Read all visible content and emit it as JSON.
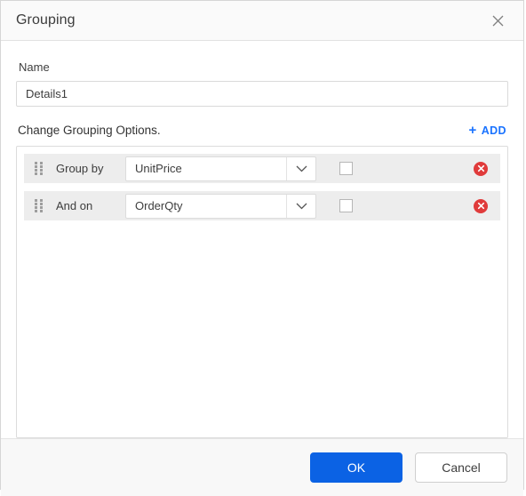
{
  "dialog": {
    "title": "Grouping",
    "close_icon": "close-icon"
  },
  "form": {
    "name_label": "Name",
    "name_value": "Details1",
    "name_placeholder": ""
  },
  "options": {
    "section_title": "Change Grouping Options.",
    "add_label": "ADD",
    "add_plus": "+",
    "rows": [
      {
        "label": "Group by",
        "field": "UnitPrice",
        "checked": false,
        "handle_icon": "drag-handle-icon",
        "delete_icon": "delete-circle-icon",
        "chevron_icon": "chevron-down-icon"
      },
      {
        "label": "And on",
        "field": "OrderQty",
        "checked": false,
        "handle_icon": "drag-handle-icon",
        "delete_icon": "delete-circle-icon",
        "chevron_icon": "chevron-down-icon"
      }
    ]
  },
  "footer": {
    "ok_label": "OK",
    "cancel_label": "Cancel"
  },
  "colors": {
    "accent_blue": "#0b62e4",
    "link_blue": "#1a73ff",
    "delete_red": "#e03b3b",
    "row_bg": "#ededed"
  }
}
